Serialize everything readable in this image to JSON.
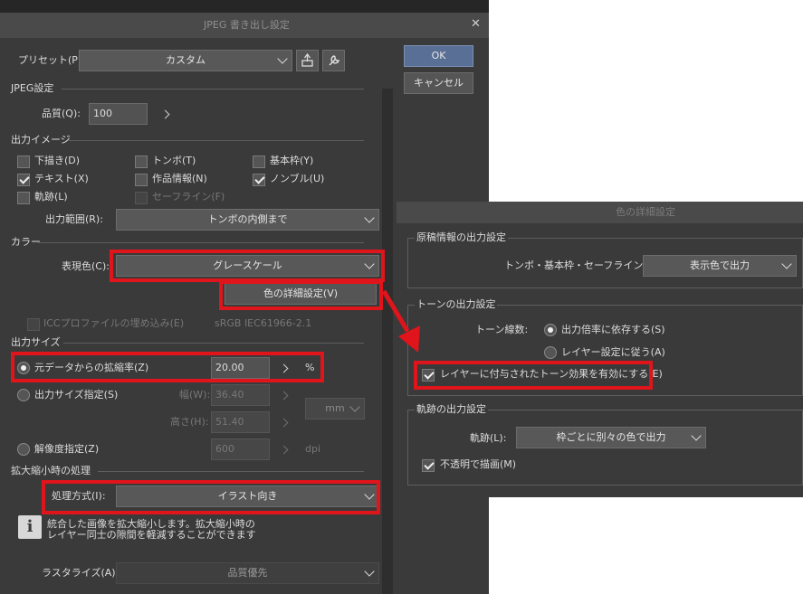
{
  "jpeg_dialog": {
    "title": "JPEG 書き出し設定",
    "close": "✕",
    "preset_label": "プリセット(P):",
    "preset_value": "カスタム",
    "ok": "OK",
    "cancel": "キャンセル",
    "jpeg_section": "JPEG設定",
    "quality_label": "品質(Q):",
    "quality_value": "100",
    "output_image_section": "出力イメージ",
    "checkboxes": [
      {
        "label": "下描き(D)",
        "checked": false
      },
      {
        "label": "トンボ(T)",
        "checked": false
      },
      {
        "label": "基本枠(Y)",
        "checked": false
      },
      {
        "label": "テキスト(X)",
        "checked": true
      },
      {
        "label": "作品情報(N)",
        "checked": false
      },
      {
        "label": "ノンブル(U)",
        "checked": true
      },
      {
        "label": "軌跡(L)",
        "checked": false
      },
      {
        "label": "セーフライン(F)",
        "checked": false
      }
    ],
    "output_range_label": "出力範囲(R):",
    "output_range_value": "トンボの内側まで",
    "color_section": "カラー",
    "expression_color_label": "表現色(C):",
    "expression_color_value": "グレースケール",
    "color_detail_button": "色の詳細設定(V)",
    "icc_label": "ICCプロファイルの埋め込み(E)",
    "icc_value": "sRGB IEC61966-2.1",
    "output_size_section": "出力サイズ",
    "scale_label": "元データからの拡縮率(Z)",
    "scale_value": "20.00",
    "percent": "%",
    "size_spec_label": "出力サイズ指定(S)",
    "width_label": "幅(W):",
    "width_value": "36.40",
    "height_label": "高さ(H):",
    "height_value": "51.40",
    "unit_value": "mm",
    "resolution_label": "解像度指定(Z)",
    "resolution_value": "600",
    "dpi": "dpi",
    "scaling_section": "拡大縮小時の処理",
    "processing_label": "処理方式(I):",
    "processing_value": "イラスト向き",
    "info_line1": "統合した画像を拡大縮小します。拡大縮小時の",
    "info_line2": "レイヤー同士の隙間を軽減することができます",
    "info_icon_glyph": "i",
    "rasterize_label": "ラスタライズ(A):",
    "rasterize_value": "品質優先"
  },
  "color_detail_dialog": {
    "title": "色の詳細設定",
    "manuscript_section": "原稿情報の出力設定",
    "trim_label": "トンボ・基本枠・セーフライン(T):",
    "trim_value": "表示色で出力",
    "tone_section": "トーンの出力設定",
    "tone_lines_label": "トーン線数:",
    "tone_option1": "出力倍率に依存する(S)",
    "tone_option2": "レイヤー設定に従う(A)",
    "tone_effect_checkbox": "レイヤーに付与されたトーン効果を有効にする(E)",
    "trace_section": "軌跡の出力設定",
    "trace_label": "軌跡(L):",
    "trace_value": "枠ごとに別々の色で出力",
    "opaque_checkbox": "不透明で描画(M)"
  },
  "colors": {
    "dialog_bg": "#3a3a3a",
    "ok_button": "#5a6f95",
    "highlight_red": "#e0141b"
  },
  "icons": [
    "close-icon",
    "chevron-down-icon",
    "chevron-right-icon",
    "add-preset-icon",
    "wrench-icon",
    "info-icon",
    "arrow-icon"
  ]
}
